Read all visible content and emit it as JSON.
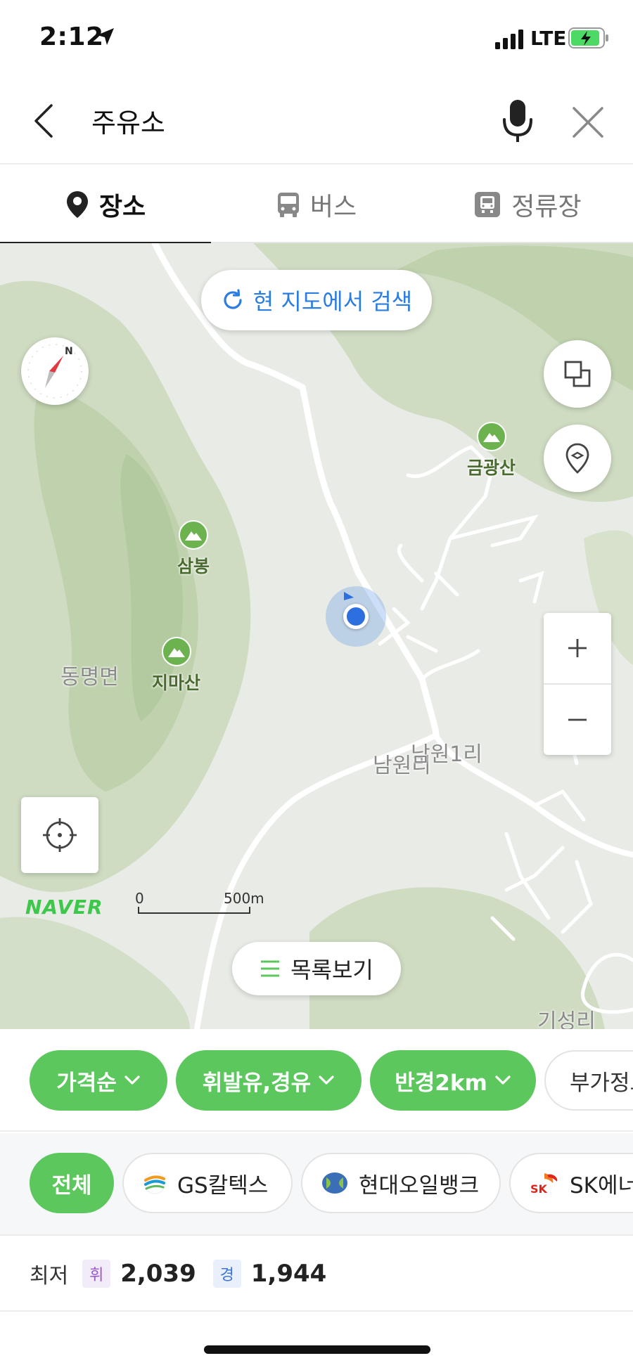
{
  "status": {
    "time": "2:12",
    "network": "LTE"
  },
  "search": {
    "query": "주유소"
  },
  "tabs": [
    {
      "label": "장소",
      "icon": "place-pin-icon",
      "active": true
    },
    {
      "label": "버스",
      "icon": "bus-icon",
      "active": false
    },
    {
      "label": "정류장",
      "icon": "bus-stop-icon",
      "active": false
    }
  ],
  "map": {
    "research_label": "현 지도에서 검색",
    "list_label": "목록보기",
    "logo": "NAVER",
    "scale_start": "0",
    "scale_end": "500m",
    "compass_letter": "N",
    "places": [
      {
        "name": "금광산"
      },
      {
        "name": "삼봉"
      },
      {
        "name": "지마산"
      }
    ],
    "areas": {
      "dongmyeong": "동명면",
      "namwon": "남원리",
      "namwon1": "남원1리",
      "giseong": "기성리"
    },
    "colors": {
      "forest": "#cfdcc2",
      "forest_dark": "#b9cda6",
      "base": "#e9ece6",
      "road": "#ffffff",
      "accent": "#2b7de1"
    }
  },
  "filters": [
    {
      "label": "가격순"
    },
    {
      "label": "휘발유,경유"
    },
    {
      "label": "반경2km"
    },
    {
      "label": "부가정보"
    }
  ],
  "brands": [
    {
      "label": "전체"
    },
    {
      "label": "GS칼텍스"
    },
    {
      "label": "현대오일뱅크"
    },
    {
      "label": "SK에너지"
    }
  ],
  "prices": {
    "min_label": "최저",
    "gasoline_tag": "휘",
    "gasoline_price": "2,039",
    "diesel_tag": "경",
    "diesel_price": "1,944"
  },
  "accent_green": "#5bc75d"
}
